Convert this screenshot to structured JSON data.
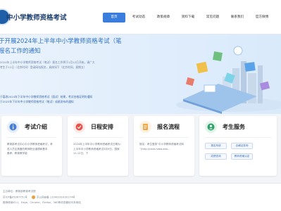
{
  "header": {
    "site_title": "中小学教师资格考试",
    "nav": [
      {
        "label": "首页",
        "active": true
      },
      {
        "label": "考试动态",
        "active": false
      },
      {
        "label": "政策规章",
        "active": false
      },
      {
        "label": "资料下载",
        "active": false
      },
      {
        "label": "常见问题",
        "active": false
      },
      {
        "label": "联系我们",
        "active": false
      },
      {
        "label": "官方微博",
        "active": false
      }
    ]
  },
  "banner": {
    "headline_line1": "于开展2024年上半年中小学教师资格考试（笔",
    "headline_line2": "报名工作的通知",
    "desc_line1": "2024年上半年中小学教师资格考试（笔试）报名工作将于1月12日开始，请广大",
    "desc_line2": "考生于12日（北京时间）登录网站报名，具体如下（北京时间，星期五）",
    "notice_line1": "于篡改2024年下半年中小学教师资格考试（面试）结果，考试合格证明的通知",
    "notice_line2": "于2023年下半年中小学教师资格考试（笔试）成绩发布的通知"
  },
  "cards": [
    {
      "title": "考试介绍",
      "text": [
        "教育部考试中心中小学教师资格考试，考",
        "查人员应具备的教师职业道德和基本",
        "素养，教育教学能"
      ]
    },
    {
      "title": "日程安排",
      "text": [
        "2024年上半年中小学教师资格考试日期为：",
        "上半年中小学教师资格考试3月9日，国家",
        "11-12日，下"
      ]
    },
    {
      "title": "报名流程",
      "text": [
        "报名：考生登录“中小学教师资格考试网",
        "”(http://ntce.neea.edu..."
      ]
    },
    {
      "title": "考生服务",
      "services": [
        "报名系统",
        "合格证查询",
        "成绩查询",
        "教师资格认定"
      ]
    }
  ],
  "footer": {
    "line1": "主办单位：教育部教育考试院",
    "line2_left": "京ICP备05067751号",
    "line2_right": "京公网安备 11040202430174号",
    "line3": "推荐使用IE11、Edge、Chrome、Firefox、360等浏览器访问本网站"
  },
  "colors": {
    "nav_active": "#3b7ddd",
    "title": "#1b3d6d",
    "headline": "#2d71c7",
    "card_icon_1": "#4a7fd4",
    "card_icon_2": "#e5534b",
    "card_icon_3": "#f0a540",
    "card_icon_4": "#2fa36b"
  }
}
